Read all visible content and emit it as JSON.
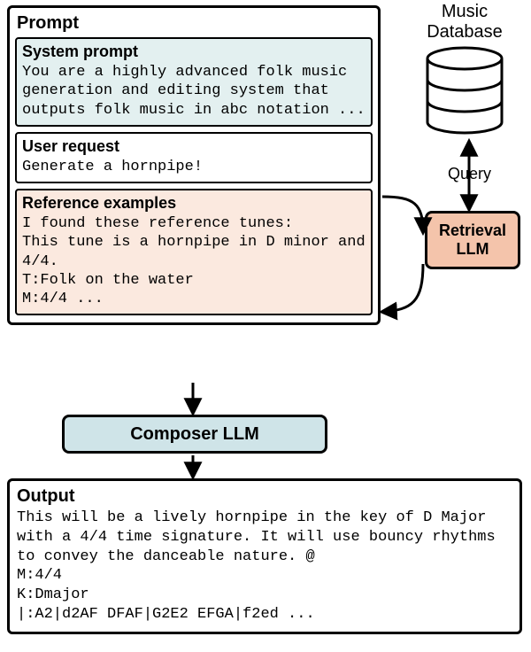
{
  "prompt": {
    "label": "Prompt",
    "system": {
      "title": "System prompt",
      "body": "You are a highly advanced folk music generation and editing system that outputs folk music in abc notation ..."
    },
    "user": {
      "title": "User request",
      "body": "Generate a hornpipe!"
    },
    "reference": {
      "title": "Reference examples",
      "intro": "I found these reference tunes:",
      "desc": "This tune is a hornpipe in D minor and 4/4.",
      "t": "T:Folk on the water",
      "m": "M:4/4 ..."
    }
  },
  "database": {
    "title_line1": "Music",
    "title_line2": "Database"
  },
  "query_label": "Query",
  "retrieval": {
    "line1": "Retrieval",
    "line2": "LLM"
  },
  "composer": "Composer LLM",
  "output": {
    "label": "Output",
    "desc": "This will be a lively hornpipe in the key of D Major with a 4/4 time signature. It will use bouncy rhythms to convey the danceable nature. @",
    "m": "M:4/4",
    "k": "K:Dmajor",
    "notes": "|:A2|d2AF DFAF|G2E2 EFGA|f2ed ..."
  }
}
